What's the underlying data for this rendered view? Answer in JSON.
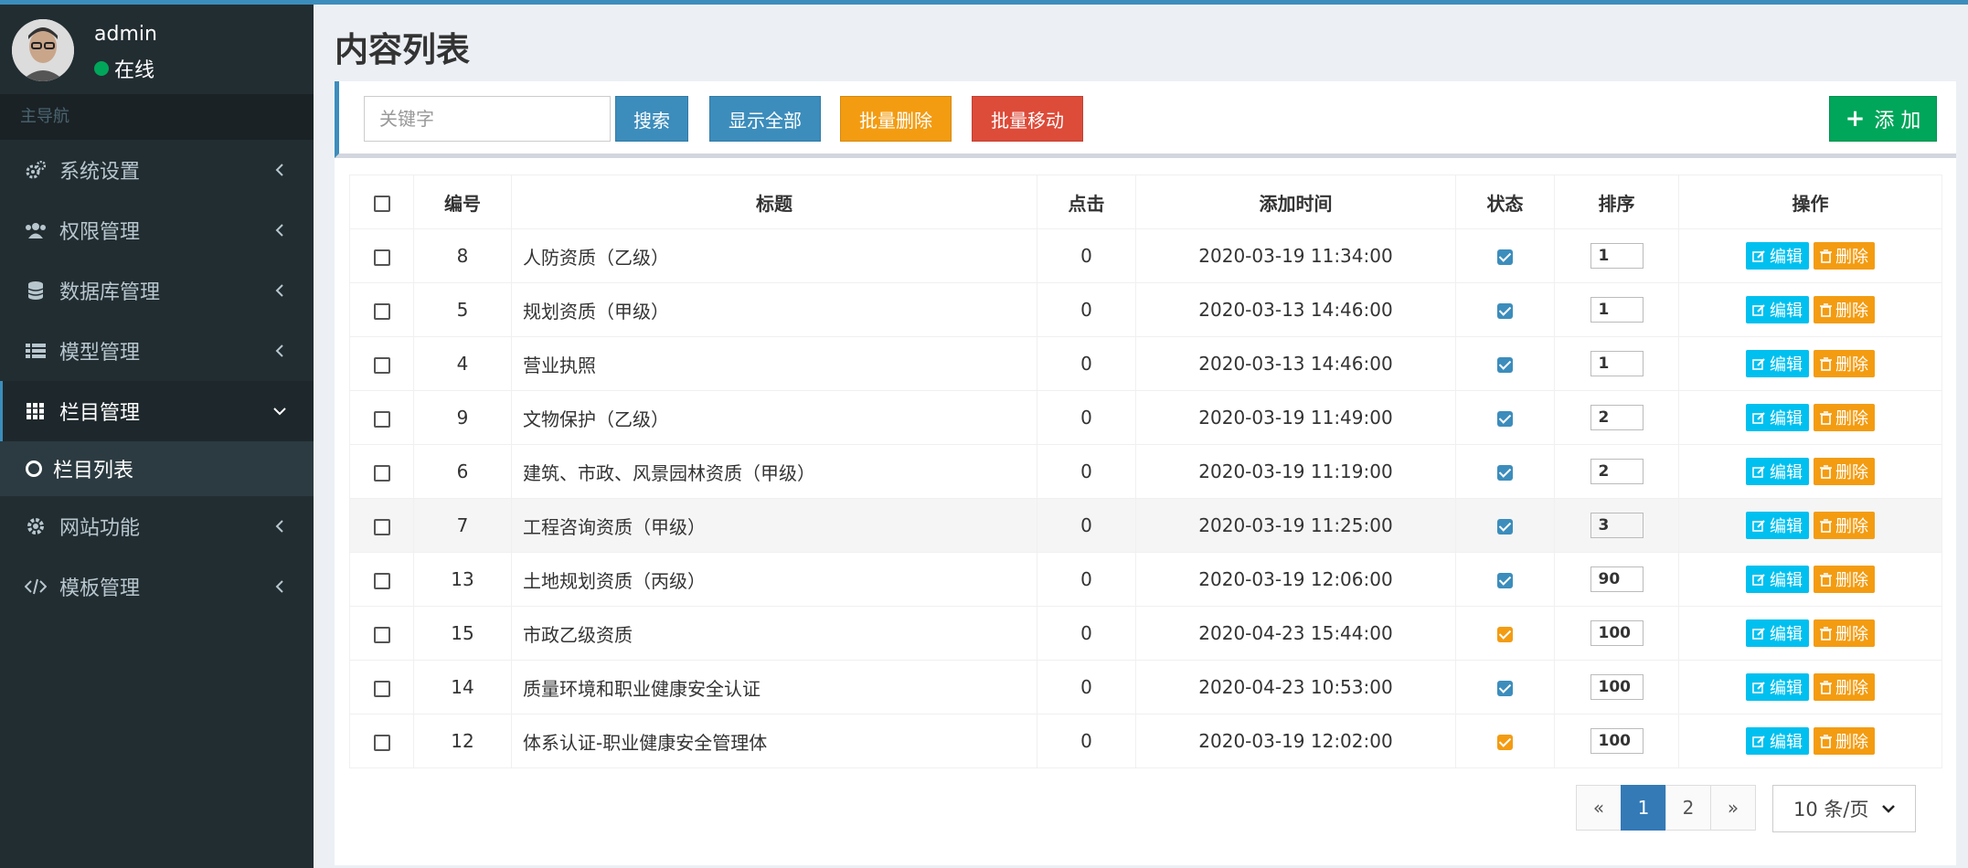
{
  "user": {
    "name": "admin",
    "status": "在线"
  },
  "nav": {
    "header": "主导航",
    "items": [
      {
        "label": "系统设置",
        "icon": "gears-icon"
      },
      {
        "label": "权限管理",
        "icon": "users-icon"
      },
      {
        "label": "数据库管理",
        "icon": "database-icon"
      },
      {
        "label": "模型管理",
        "icon": "list-icon"
      },
      {
        "label": "栏目管理",
        "icon": "grid-icon"
      },
      {
        "label": "网站功能",
        "icon": "gear-icon"
      },
      {
        "label": "模板管理",
        "icon": "code-icon"
      }
    ],
    "sub_item": "栏目列表"
  },
  "page": {
    "title": "内容列表"
  },
  "toolbar": {
    "search_placeholder": "关键字",
    "search_label": "搜索",
    "show_all_label": "显示全部",
    "batch_delete_label": "批量删除",
    "batch_move_label": "批量移动",
    "add_label": "添 加"
  },
  "table": {
    "headers": [
      "编号",
      "标题",
      "点击",
      "添加时间",
      "状态",
      "排序",
      "操作"
    ],
    "edit_label": "编辑",
    "delete_label": "删除",
    "rows": [
      {
        "id": "8",
        "title": "人防资质（乙级）",
        "clicks": "0",
        "time": "2020-03-19 11:34:00",
        "status": "blue",
        "sort": "1"
      },
      {
        "id": "5",
        "title": "规划资质（甲级）",
        "clicks": "0",
        "time": "2020-03-13 14:46:00",
        "status": "blue",
        "sort": "1"
      },
      {
        "id": "4",
        "title": "营业执照",
        "clicks": "0",
        "time": "2020-03-13 14:46:00",
        "status": "blue",
        "sort": "1"
      },
      {
        "id": "9",
        "title": "文物保护（乙级）",
        "clicks": "0",
        "time": "2020-03-19 11:49:00",
        "status": "blue",
        "sort": "2"
      },
      {
        "id": "6",
        "title": "建筑、市政、风景园林资质（甲级）",
        "clicks": "0",
        "time": "2020-03-19 11:19:00",
        "status": "blue",
        "sort": "2"
      },
      {
        "id": "7",
        "title": "工程咨询资质（甲级）",
        "clicks": "0",
        "time": "2020-03-19 11:25:00",
        "status": "blue",
        "sort": "3"
      },
      {
        "id": "13",
        "title": "土地规划资质（丙级）",
        "clicks": "0",
        "time": "2020-03-19 12:06:00",
        "status": "blue",
        "sort": "90"
      },
      {
        "id": "15",
        "title": "市政乙级资质",
        "clicks": "0",
        "time": "2020-04-23 15:44:00",
        "status": "orange",
        "sort": "100"
      },
      {
        "id": "14",
        "title": "质量环境和职业健康安全认证",
        "clicks": "0",
        "time": "2020-04-23 10:53:00",
        "status": "blue",
        "sort": "100"
      },
      {
        "id": "12",
        "title": "体系认证-职业健康安全管理体",
        "clicks": "0",
        "time": "2020-03-19 12:02:00",
        "status": "orange",
        "sort": "100"
      }
    ]
  },
  "pagination": {
    "prev": "«",
    "pages": [
      "1",
      "2"
    ],
    "next": "»",
    "per_page": "10 条/页"
  },
  "colors": {
    "primary": "#3c8dbc",
    "success": "#00a65a",
    "warning": "#f39c12",
    "danger": "#dd4b39",
    "info": "#00c0ef",
    "sidebar": "#222d32"
  }
}
